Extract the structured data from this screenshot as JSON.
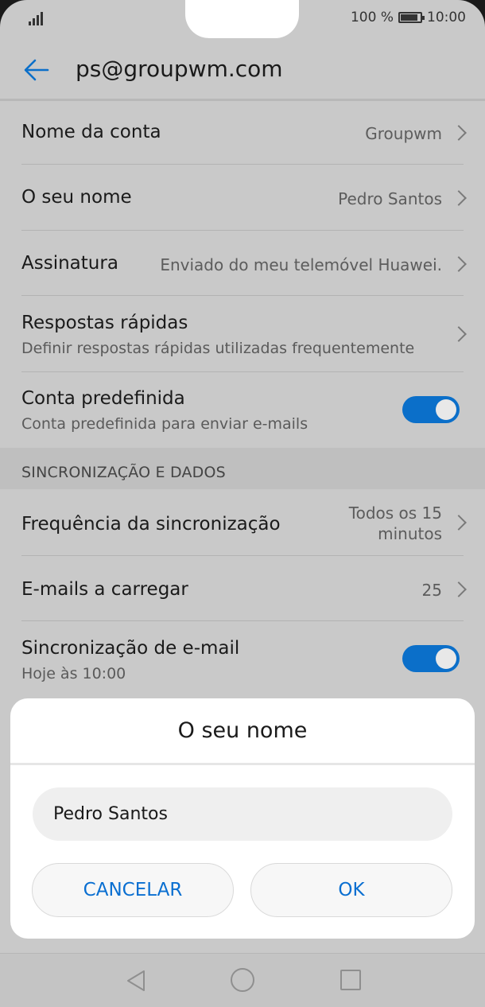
{
  "status": {
    "battery": "100 %",
    "time": "10:00"
  },
  "header": {
    "title": "ps@groupwm.com"
  },
  "settings": {
    "account_name": {
      "label": "Nome da conta",
      "value": "Groupwm"
    },
    "your_name": {
      "label": "O seu nome",
      "value": "Pedro Santos"
    },
    "signature": {
      "label": "Assinatura",
      "value": "Enviado do meu telemóvel Huawei."
    },
    "quick_replies": {
      "label": "Respostas rápidas",
      "sub": "Definir respostas rápidas utilizadas frequentemente"
    },
    "default_account": {
      "label": "Conta predefinida",
      "sub": "Conta predefinida para enviar e-mails",
      "enabled": true
    },
    "section_sync": "SINCRONIZAÇÃO E DADOS",
    "sync_frequency": {
      "label": "Frequência da sincronização",
      "value_line1": "Todos os 15",
      "value_line2": "minutos"
    },
    "emails_to_load": {
      "label": "E-mails a carregar",
      "value": "25"
    },
    "email_sync": {
      "label": "Sincronização de e-mail",
      "sub": "Hoje às 10:00",
      "enabled": true
    }
  },
  "dialog": {
    "title": "O seu nome",
    "input_value": "Pedro Santos",
    "cancel": "CANCELAR",
    "ok": "OK"
  },
  "colors": {
    "accent": "#0b6fc9",
    "button_text": "#0a6fd1"
  }
}
